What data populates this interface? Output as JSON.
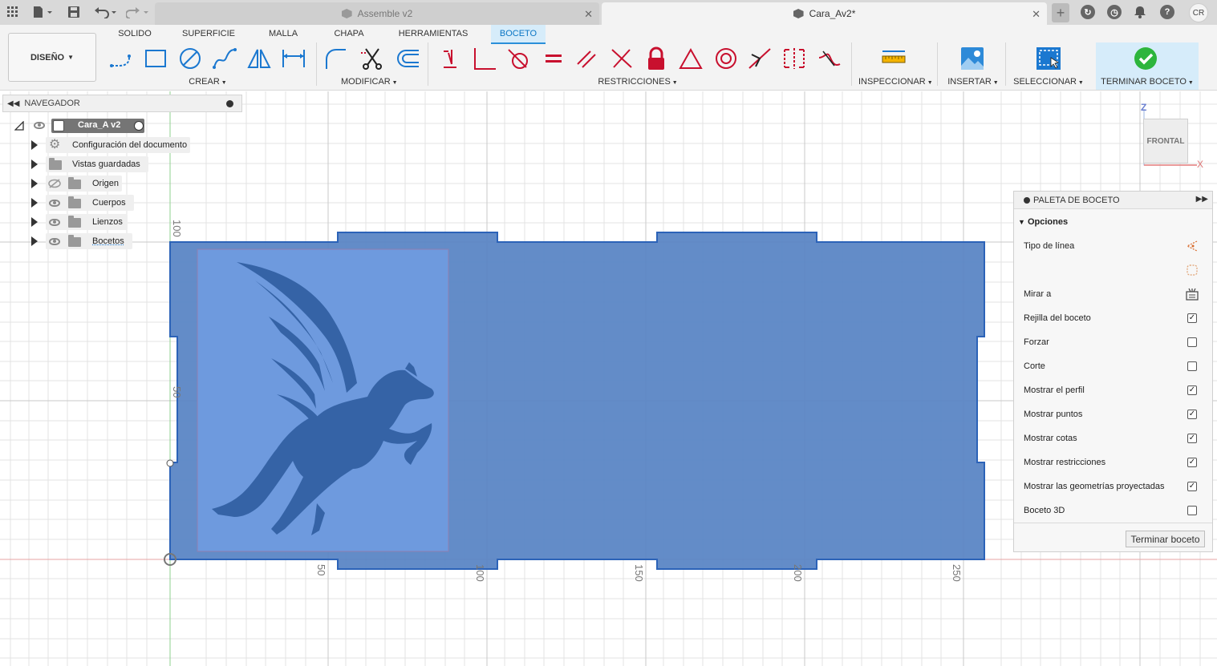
{
  "titlebar": {
    "tabs": [
      {
        "label": "Assemble v2",
        "active": false
      },
      {
        "label": "Cara_Av2*",
        "active": true
      }
    ],
    "user_initials": "CR"
  },
  "ribbon": {
    "workspace": "DISEÑO",
    "tabs": [
      "SOLIDO",
      "SUPERFICIE",
      "MALLA",
      "CHAPA",
      "HERRAMIENTAS",
      "BOCETO"
    ],
    "active_tab": "BOCETO",
    "groups": {
      "crear": "CREAR",
      "modificar": "MODIFICAR",
      "restricciones": "RESTRICCIONES",
      "inspeccionar": "INSPECCIONAR",
      "insertar": "INSERTAR",
      "seleccionar": "SELECCIONAR",
      "terminar": "TERMINAR BOCETO"
    }
  },
  "navigator": {
    "title": "NAVEGADOR",
    "root": "Cara_A v2",
    "items": [
      {
        "label": "Configuración del documento",
        "icon": "gear-icon"
      },
      {
        "label": "Vistas guardadas",
        "icon": "folder-icon"
      },
      {
        "label": "Origen",
        "icon": "folder-icon",
        "visible": false
      },
      {
        "label": "Cuerpos",
        "icon": "folder-icon",
        "visible": true
      },
      {
        "label": "Lienzos",
        "icon": "folder-icon",
        "visible": true
      },
      {
        "label": "Bocetos",
        "icon": "folder-icon",
        "visible": true
      }
    ]
  },
  "viewcube": {
    "face": "FRONTAL",
    "axis_z": "Z",
    "axis_x": "X"
  },
  "canvas": {
    "ruler_labels_x": [
      "50",
      "100",
      "150",
      "200",
      "250"
    ],
    "ruler_labels_y": [
      "100",
      "50"
    ],
    "sketch_fill": "#5b86c5",
    "image_fill": "#6e9ade",
    "pegasus_color": "#3563a6"
  },
  "palette": {
    "title": "PALETA DE BOCETO",
    "section": "Opciones",
    "rows": [
      {
        "label": "Tipo de línea",
        "control": "linetype-icon"
      },
      {
        "label": "",
        "control": "construction-icon"
      },
      {
        "label": "Mirar a",
        "control": "look-at-icon"
      },
      {
        "label": "Rejilla del boceto",
        "checked": true
      },
      {
        "label": "Forzar",
        "checked": false
      },
      {
        "label": "Corte",
        "checked": false
      },
      {
        "label": "Mostrar el perfil",
        "checked": true
      },
      {
        "label": "Mostrar puntos",
        "checked": true
      },
      {
        "label": "Mostrar cotas",
        "checked": true
      },
      {
        "label": "Mostrar restricciones",
        "checked": true
      },
      {
        "label": "Mostrar las geometrías proyectadas",
        "checked": true
      },
      {
        "label": "Boceto 3D",
        "checked": false
      }
    ],
    "button": "Terminar boceto"
  }
}
